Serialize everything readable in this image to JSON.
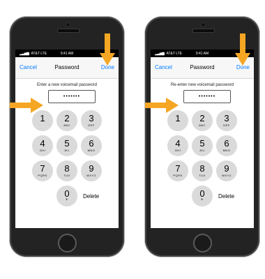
{
  "colors": {
    "accent": "#007aff",
    "arrow": "#f5a623",
    "key_bg": "#dadada",
    "phone_body": "#232323"
  },
  "screens": [
    {
      "status": {
        "carrier": "AT&T",
        "network": "LTE",
        "time": "9:41 AM"
      },
      "nav": {
        "cancel": "Cancel",
        "title": "Password",
        "done": "Done"
      },
      "prompt": "Enter a new voicemail password",
      "password_value": "•••••••"
    },
    {
      "status": {
        "carrier": "AT&T",
        "network": "LTE",
        "time": "9:41 AM"
      },
      "nav": {
        "cancel": "Cancel",
        "title": "Password",
        "done": "Done"
      },
      "prompt": "Re-enter new voicemail password",
      "password_value": "•••••••"
    }
  ],
  "keypad": {
    "keys": [
      {
        "digit": "1",
        "letters": ""
      },
      {
        "digit": "2",
        "letters": "ABC"
      },
      {
        "digit": "3",
        "letters": "DEF"
      },
      {
        "digit": "4",
        "letters": "GHI"
      },
      {
        "digit": "5",
        "letters": "JKL"
      },
      {
        "digit": "6",
        "letters": "MNO"
      },
      {
        "digit": "7",
        "letters": "PQRS"
      },
      {
        "digit": "8",
        "letters": "TUV"
      },
      {
        "digit": "9",
        "letters": "WXYZ"
      },
      {
        "digit": "0",
        "letters": "+"
      }
    ],
    "delete_label": "Delete"
  },
  "arrows": [
    {
      "icon": "arrow-down-icon",
      "points_to": "done-button"
    },
    {
      "icon": "arrow-right-icon",
      "points_to": "password-field"
    }
  ]
}
